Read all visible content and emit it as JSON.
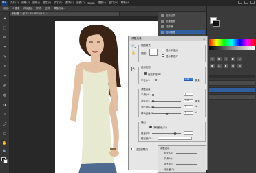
{
  "menubar": {
    "logo": "Ps",
    "items": [
      "文件(F)",
      "编辑(E)",
      "图像(I)",
      "图层(L)",
      "文字(Y)",
      "选择(S)",
      "滤镜(T)",
      "3D(D)",
      "视图(V)",
      "窗口(W)",
      "帮助(H)"
    ]
  },
  "optionsbar": {
    "items": [
      "羽化:",
      "0 像素",
      "消除锯齿",
      "样式:",
      "正常",
      "调整边缘..."
    ]
  },
  "document": {
    "tab_title": "未标题-1 @ 72.7%(RGB/8#) ×"
  },
  "tools": [
    "⌖",
    "⬚",
    "ᘛ",
    "⌗",
    "✎",
    "⚕",
    "✦",
    "✐",
    "◍",
    "⬗",
    "T",
    "⤴",
    "▭",
    "✋",
    "🔍"
  ],
  "history": {
    "rows": [
      "历史记录",
      "新建图层",
      "油漆桶",
      "复制图层",
      "蒙版"
    ]
  },
  "dialog": {
    "title": "调整边缘",
    "close": "×",
    "view_mode_label": "视图模式",
    "view_label": "视图:",
    "show_radius": "显示半径(J)",
    "show_original": "显示原稿(P)",
    "edge_detection_label": "边缘检测",
    "smart_radius": "智能半径(A)",
    "radius_label": "半径(U):",
    "radius_value": "1.5",
    "radius_unit": "像素",
    "adjust_edge_label": "调整边缘",
    "smooth_label": "平滑(H):",
    "smooth_value": "0",
    "feather_label": "羽化(E):",
    "feather_value": "0.0",
    "feather_unit": "像素",
    "contrast_label": "对比度(C):",
    "contrast_value": "0",
    "contrast_unit": "%",
    "shift_label": "移动边缘(S):",
    "shift_value": "0",
    "shift_unit": "%",
    "output_label": "输出",
    "decontaminate": "净化颜色(D)",
    "amount_label": "数量(N):",
    "amount_value": "",
    "output_to_label": "输出到(O):",
    "remember": "记住设置(T)",
    "ok": "确定",
    "cancel": "取消"
  },
  "adjustments": {
    "title": "调整边缘",
    "rows": [
      "半径(U):",
      "平滑(H):",
      "羽化(E):",
      "对比度(C):"
    ]
  },
  "colors": {
    "accent": "#3b78d0"
  }
}
